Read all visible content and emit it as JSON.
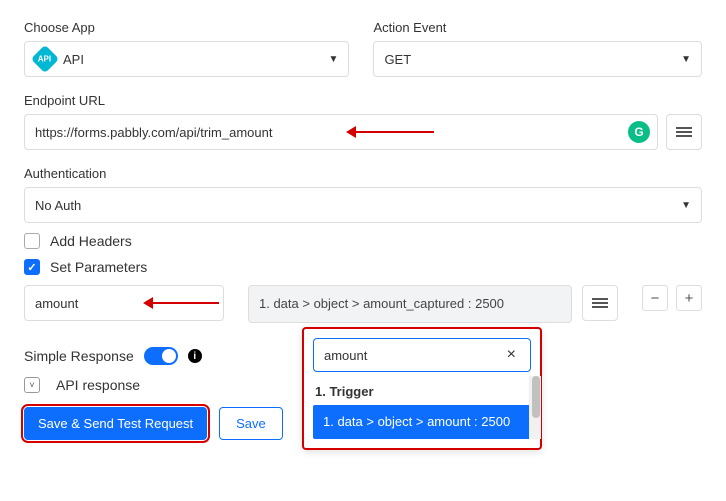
{
  "app": {
    "choose_label": "Choose App",
    "value": "API",
    "action_label": "Action Event",
    "action_value": "GET"
  },
  "endpoint": {
    "label": "Endpoint URL",
    "value": "https://forms.pabbly.com/api/trim_amount"
  },
  "auth": {
    "label": "Authentication",
    "value": "No Auth"
  },
  "options": {
    "add_headers_label": "Add Headers",
    "set_params_label": "Set Parameters"
  },
  "params": {
    "key_value": "amount",
    "mapped_text": "1. data > object > amount_captured : 2500"
  },
  "simple_response": {
    "label": "Simple Response"
  },
  "api_response": {
    "label": "API response"
  },
  "buttons": {
    "primary": "Save & Send Test Request",
    "save": "Save"
  },
  "dropdown": {
    "search_value": "amount",
    "heading": "1. Trigger",
    "selected": "1. data > object > amount : 2500"
  }
}
